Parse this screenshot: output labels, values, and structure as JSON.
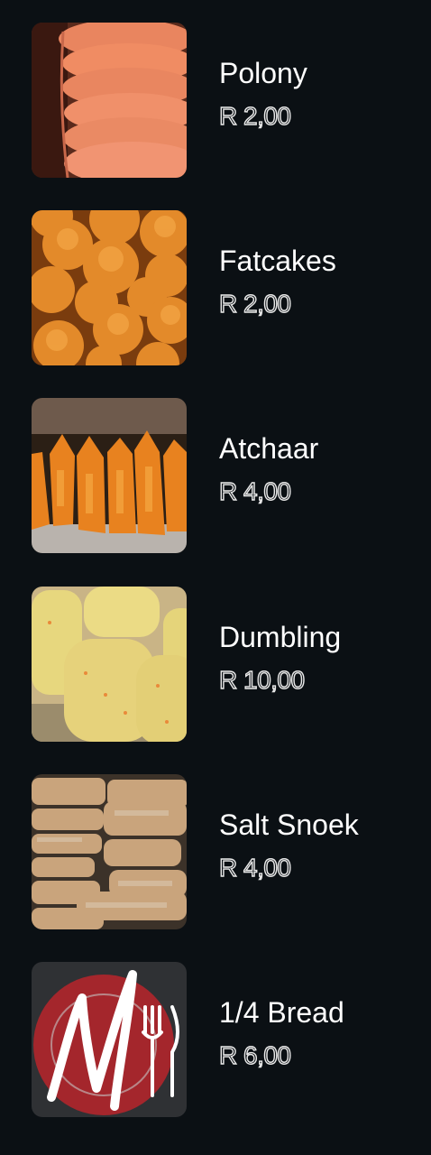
{
  "menu": {
    "items": [
      {
        "name": "Polony",
        "price": "R 2,00",
        "image": "polony-slices-photo"
      },
      {
        "name": "Fatcakes",
        "price": "R 2,00",
        "image": "fatcakes-photo"
      },
      {
        "name": "Atchaar",
        "price": "R 4,00",
        "image": "atchaar-bags-photo"
      },
      {
        "name": "Dumbling",
        "price": "R 10,00",
        "image": "dumpling-photo"
      },
      {
        "name": "Salt Snoek",
        "price": "R 4,00",
        "image": "salt-snoek-photo"
      },
      {
        "name": "1/4 Bread",
        "price": "R 6,00",
        "image": "restaurant-logo-placeholder"
      }
    ]
  }
}
